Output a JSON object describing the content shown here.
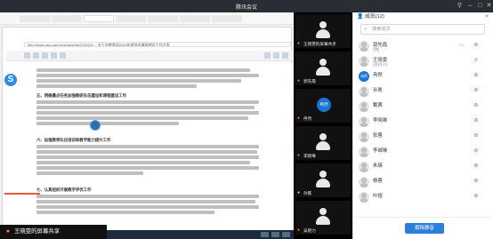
{
  "window": {
    "title": "腾讯会议"
  },
  "share": {
    "sharer_label": "王晓雯的屏幕共享",
    "address": "http://www.njxx.gov.cn/xxgk/zcfg/2020/03/…  关于市教育局2020年度党风廉政建设工作方案",
    "doc": {
      "headings": [
        "五、明确重点任务加强教研队伍建设和课程建设工作",
        "六、加强教师队伍培训和教学能力提升工作",
        "七、认真组织开展教学评优工作"
      ]
    }
  },
  "tiles": [
    {
      "label": "王晓雯的屏幕共享",
      "avatar": "silhouette",
      "mic": "on"
    },
    {
      "label": "郭先霞",
      "avatar": "silhouette",
      "mic": "on"
    },
    {
      "label": "冉然",
      "avatar": "bubble",
      "bubble_text": "冉然",
      "mic": "on"
    },
    {
      "label": "李晓琳",
      "avatar": "silhouette",
      "mic": "on"
    },
    {
      "label": "孙冕",
      "avatar": "silhouette",
      "mic": "off"
    },
    {
      "label": "吴晓力",
      "avatar": "silhouette",
      "mic": "on"
    }
  ],
  "members": {
    "title": "成员(12)",
    "search_placeholder": "搜索成员",
    "list": [
      {
        "name": "郭先霞",
        "sub": "(我)",
        "mic": "muted"
      },
      {
        "name": "王晓雯",
        "sub": "(主持人)",
        "mic": "gray"
      },
      {
        "name": "冉然",
        "sub": "",
        "mic": "muted",
        "avatar_text": "冉然"
      },
      {
        "name": "孙冕",
        "sub": "",
        "mic": "muted"
      },
      {
        "name": "戴茜",
        "sub": "",
        "mic": "muted"
      },
      {
        "name": "李晓琳",
        "sub": "",
        "mic": "muted"
      },
      {
        "name": "张蓉",
        "sub": "",
        "mic": "muted"
      },
      {
        "name": "李城琳",
        "sub": "",
        "mic": "muted"
      },
      {
        "name": "朱瑛",
        "sub": "",
        "mic": "muted"
      },
      {
        "name": "杨蓉",
        "sub": "",
        "mic": "muted"
      },
      {
        "name": "叶娅",
        "sub": "",
        "mic": "muted"
      }
    ],
    "unmute_all": "解除静音"
  },
  "icons": {
    "mic_on": "mic-icon",
    "video": "video-icon",
    "search": "search-icon",
    "members": "members-icon",
    "close": "close-icon"
  },
  "colors": {
    "accent": "#2a7fdc",
    "mute_red": "#e0513a",
    "sharer_mic": "#ff7a3c"
  }
}
